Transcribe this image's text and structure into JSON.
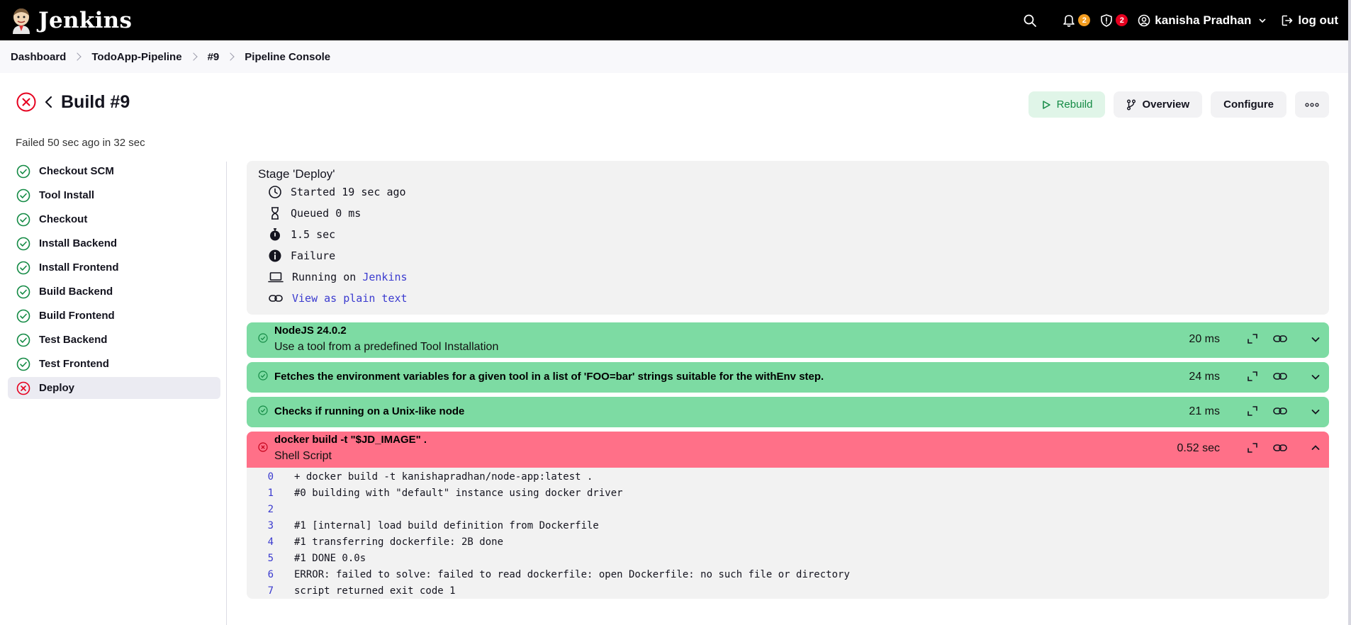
{
  "header": {
    "app_name": "Jenkins",
    "notifications_count": "2",
    "security_count": "2",
    "user_name": "kanisha Pradhan",
    "logout_label": "log out"
  },
  "breadcrumb": [
    "Dashboard",
    "TodoApp-Pipeline",
    "#9",
    "Pipeline Console"
  ],
  "build": {
    "title": "Build #9",
    "status": "failed",
    "summary": "Failed 50 sec ago in 32 sec"
  },
  "actions": {
    "rebuild": "Rebuild",
    "overview": "Overview",
    "configure": "Configure"
  },
  "stages": [
    {
      "label": "Checkout SCM",
      "status": "success"
    },
    {
      "label": "Tool Install",
      "status": "success"
    },
    {
      "label": "Checkout",
      "status": "success"
    },
    {
      "label": "Install Backend",
      "status": "success"
    },
    {
      "label": "Install Frontend",
      "status": "success"
    },
    {
      "label": "Build Backend",
      "status": "success"
    },
    {
      "label": "Build Frontend",
      "status": "success"
    },
    {
      "label": "Test Backend",
      "status": "success"
    },
    {
      "label": "Test Frontend",
      "status": "success"
    },
    {
      "label": "Deploy",
      "status": "failed",
      "selected": true
    }
  ],
  "stage_info": {
    "title": "Stage 'Deploy'",
    "started": "Started 19 sec ago",
    "queued": "Queued 0 ms",
    "duration": "1.5 sec",
    "result": "Failure",
    "running_on_prefix": "Running on",
    "running_on_node": "Jenkins",
    "plain_text_link": "View as plain text"
  },
  "steps": [
    {
      "title": "NodeJS 24.0.2",
      "subtitle": "Use a tool from a predefined Tool Installation",
      "time": "20 ms",
      "status": "success"
    },
    {
      "title": "Fetches the environment variables for a given tool in a list of 'FOO=bar' strings suitable for the withEnv step.",
      "subtitle": "",
      "time": "24 ms",
      "status": "success"
    },
    {
      "title": "Checks if running on a Unix-like node",
      "subtitle": "",
      "time": "21 ms",
      "status": "success"
    },
    {
      "title": "docker build -t \"$JD_IMAGE\" .",
      "subtitle": "Shell Script",
      "time": "0.52 sec",
      "status": "failed"
    }
  ],
  "log": [
    {
      "n": "0",
      "text": "+ docker build -t kanishapradhan/node-app:latest ."
    },
    {
      "n": "1",
      "text": "#0 building with \"default\" instance using docker driver"
    },
    {
      "n": "2",
      "text": ""
    },
    {
      "n": "3",
      "text": "#1 [internal] load build definition from Dockerfile"
    },
    {
      "n": "4",
      "text": "#1 transferring dockerfile: 2B done"
    },
    {
      "n": "5",
      "text": "#1 DONE 0.0s"
    },
    {
      "n": "6",
      "text": "ERROR: failed to solve: failed to read dockerfile: open Dockerfile: no such file or directory"
    },
    {
      "n": "7",
      "text": "script returned exit code 1"
    }
  ],
  "colors": {
    "success_step": "#7ddba3",
    "failed_step": "#ff7088",
    "success_icon": "#138a44",
    "failed_icon": "#e6001f",
    "link": "#3b3bcf"
  }
}
